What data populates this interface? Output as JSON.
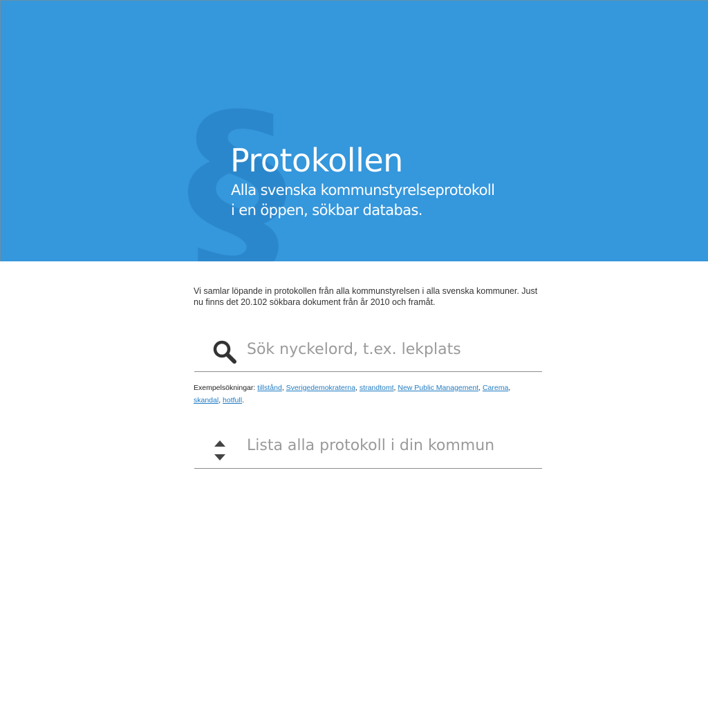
{
  "header": {
    "section_symbol": "§",
    "title": "Protokollen",
    "subtitle_line1": "Alla svenska kommunstyrelseprotokoll",
    "subtitle_line2": "i en öppen, sökbar databas."
  },
  "intro": {
    "text": "Vi samlar löpande in protokollen från alla kommunstyrelsen i alla svenska kommuner. Just nu finns det 20.102 sökbara dokument från år 2010 och framåt."
  },
  "search": {
    "icon": "search-icon",
    "placeholder": "Sök nyckelord, t.ex. lekplats",
    "value": ""
  },
  "examples": {
    "label": "Exempelsökningar:",
    "links": [
      "tillstånd",
      "Sverigedemokraterna",
      "strandtomt",
      "New Public Management",
      "Carema",
      "skandal",
      "hotfull"
    ],
    "end": "."
  },
  "list_municipality": {
    "icon": "sort-arrows-icon",
    "label": "Lista alla protokoll i din kommun"
  },
  "colors": {
    "header_background": "#3597dc",
    "section_symbol": "#2b87cc",
    "link": "#1f7bc3",
    "placeholder": "#9a9a9a"
  }
}
